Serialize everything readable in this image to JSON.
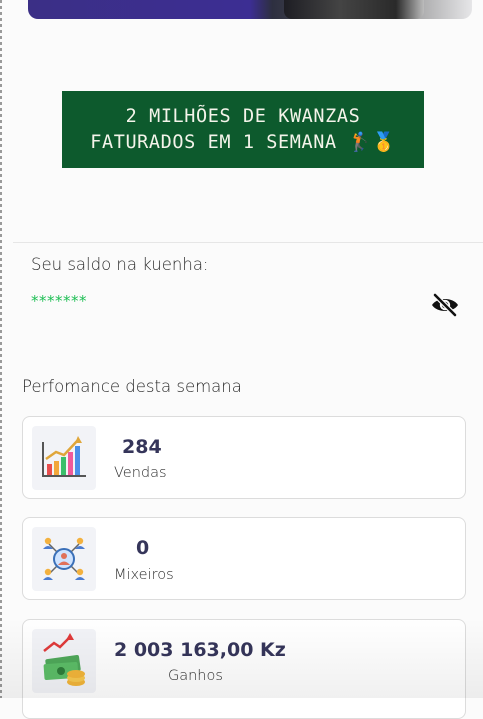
{
  "headline": {
    "line1": "2 MILHÕES DE KWANZAS",
    "line2": "FATURADOS EM 1 SEMANA 🏌️🥇"
  },
  "balance": {
    "label": "Seu saldo na kuenha:",
    "value": "*******",
    "toggle_icon": "eye-slash-icon"
  },
  "performance": {
    "title": "Perfomance desta semana",
    "cards": [
      {
        "value": "284",
        "label": "Vendas",
        "icon": "sales-chart-icon"
      },
      {
        "value": "0",
        "label": "Mixeiros",
        "icon": "network-people-icon"
      },
      {
        "value": "2 003 163,00 Kz",
        "label": "Ganhos",
        "icon": "money-stack-icon"
      }
    ]
  },
  "colors": {
    "headline_bg": "#0d5a2d",
    "balance_text": "#1fbf55",
    "stat_value": "#35355a"
  }
}
